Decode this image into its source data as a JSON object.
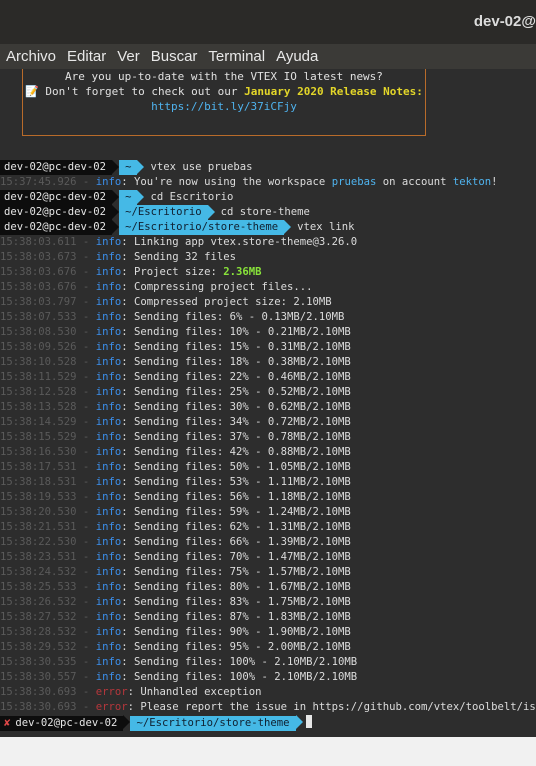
{
  "window": {
    "title": "dev-02@"
  },
  "menu": [
    "Archivo",
    "Editar",
    "Ver",
    "Buscar",
    "Terminal",
    "Ayuda"
  ],
  "banner": {
    "line1": "Are you up-to-date with the VTEX IO latest news?",
    "line2_prefix": "📝 Don't forget to check out our ",
    "line2_highlight": "January 2020 Release Notes:",
    "link": "https://bit.ly/37iCFjy"
  },
  "prompt_user": "dev-02@pc-dev-02",
  "lines": [
    {
      "kind": "prompt",
      "dir": "~",
      "cmd": "vtex use pruebas"
    },
    {
      "kind": "log",
      "ts": "15:37:45.926",
      "level": "info",
      "pre": ": You're now using the workspace ",
      "ws": "pruebas",
      "mid": " on account ",
      "acct": "tekton",
      "post": "!"
    },
    {
      "kind": "prompt",
      "dir": "~",
      "cmd": "cd Escritorio"
    },
    {
      "kind": "prompt",
      "dir": "~/Escritorio",
      "cmd": "cd store-theme"
    },
    {
      "kind": "prompt",
      "dir": "~/Escritorio/store-theme",
      "cmd": "vtex link"
    },
    {
      "kind": "log",
      "ts": "15:38:03.611",
      "level": "info",
      "pre": ": Linking app vtex.store-theme@3.26.0"
    },
    {
      "kind": "log",
      "ts": "15:38:03.673",
      "level": "info",
      "pre": ": Sending 32 files"
    },
    {
      "kind": "log",
      "ts": "15:38:03.676",
      "level": "info",
      "pre": ": Project size: ",
      "green": "2.36MB"
    },
    {
      "kind": "log",
      "ts": "15:38:03.676",
      "level": "info",
      "pre": ": Compressing project files..."
    },
    {
      "kind": "log",
      "ts": "15:38:03.797",
      "level": "info",
      "pre": ": Compressed project size: 2.10MB"
    },
    {
      "kind": "log",
      "ts": "15:38:07.533",
      "level": "info",
      "pre": ": Sending files: 6% - 0.13MB/2.10MB"
    },
    {
      "kind": "log",
      "ts": "15:38:08.530",
      "level": "info",
      "pre": ": Sending files: 10% - 0.21MB/2.10MB"
    },
    {
      "kind": "log",
      "ts": "15:38:09.526",
      "level": "info",
      "pre": ": Sending files: 15% - 0.31MB/2.10MB"
    },
    {
      "kind": "log",
      "ts": "15:38:10.528",
      "level": "info",
      "pre": ": Sending files: 18% - 0.38MB/2.10MB"
    },
    {
      "kind": "log",
      "ts": "15:38:11.529",
      "level": "info",
      "pre": ": Sending files: 22% - 0.46MB/2.10MB"
    },
    {
      "kind": "log",
      "ts": "15:38:12.528",
      "level": "info",
      "pre": ": Sending files: 25% - 0.52MB/2.10MB"
    },
    {
      "kind": "log",
      "ts": "15:38:13.528",
      "level": "info",
      "pre": ": Sending files: 30% - 0.62MB/2.10MB"
    },
    {
      "kind": "log",
      "ts": "15:38:14.529",
      "level": "info",
      "pre": ": Sending files: 34% - 0.72MB/2.10MB"
    },
    {
      "kind": "log",
      "ts": "15:38:15.529",
      "level": "info",
      "pre": ": Sending files: 37% - 0.78MB/2.10MB"
    },
    {
      "kind": "log",
      "ts": "15:38:16.530",
      "level": "info",
      "pre": ": Sending files: 42% - 0.88MB/2.10MB"
    },
    {
      "kind": "log",
      "ts": "15:38:17.531",
      "level": "info",
      "pre": ": Sending files: 50% - 1.05MB/2.10MB"
    },
    {
      "kind": "log",
      "ts": "15:38:18.531",
      "level": "info",
      "pre": ": Sending files: 53% - 1.11MB/2.10MB"
    },
    {
      "kind": "log",
      "ts": "15:38:19.533",
      "level": "info",
      "pre": ": Sending files: 56% - 1.18MB/2.10MB"
    },
    {
      "kind": "log",
      "ts": "15:38:20.530",
      "level": "info",
      "pre": ": Sending files: 59% - 1.24MB/2.10MB"
    },
    {
      "kind": "log",
      "ts": "15:38:21.531",
      "level": "info",
      "pre": ": Sending files: 62% - 1.31MB/2.10MB"
    },
    {
      "kind": "log",
      "ts": "15:38:22.530",
      "level": "info",
      "pre": ": Sending files: 66% - 1.39MB/2.10MB"
    },
    {
      "kind": "log",
      "ts": "15:38:23.531",
      "level": "info",
      "pre": ": Sending files: 70% - 1.47MB/2.10MB"
    },
    {
      "kind": "log",
      "ts": "15:38:24.532",
      "level": "info",
      "pre": ": Sending files: 75% - 1.57MB/2.10MB"
    },
    {
      "kind": "log",
      "ts": "15:38:25.533",
      "level": "info",
      "pre": ": Sending files: 80% - 1.67MB/2.10MB"
    },
    {
      "kind": "log",
      "ts": "15:38:26.532",
      "level": "info",
      "pre": ": Sending files: 83% - 1.75MB/2.10MB"
    },
    {
      "kind": "log",
      "ts": "15:38:27.532",
      "level": "info",
      "pre": ": Sending files: 87% - 1.83MB/2.10MB"
    },
    {
      "kind": "log",
      "ts": "15:38:28.532",
      "level": "info",
      "pre": ": Sending files: 90% - 1.90MB/2.10MB"
    },
    {
      "kind": "log",
      "ts": "15:38:29.532",
      "level": "info",
      "pre": ": Sending files: 95% - 2.00MB/2.10MB"
    },
    {
      "kind": "log",
      "ts": "15:38:30.535",
      "level": "info",
      "pre": ": Sending files: 100% - 2.10MB/2.10MB"
    },
    {
      "kind": "log",
      "ts": "15:38:30.557",
      "level": "info",
      "pre": ": Sending files: 100% - 2.10MB/2.10MB"
    },
    {
      "kind": "log",
      "ts": "15:38:30.693",
      "level": "error",
      "pre": ": Unhandled exception"
    },
    {
      "kind": "log",
      "ts": "15:38:30.693",
      "level": "error",
      "pre": ": Please report the issue in https://github.com/vtex/toolbelt/issues"
    },
    {
      "kind": "prompt_err",
      "dir": "~/Escritorio/store-theme",
      "cmd": ""
    }
  ],
  "colors": {
    "info": "#3b8eea",
    "error": "#b5373c",
    "prompt_dir_bg": "#45b9e6",
    "highlight": "#e3d629"
  }
}
